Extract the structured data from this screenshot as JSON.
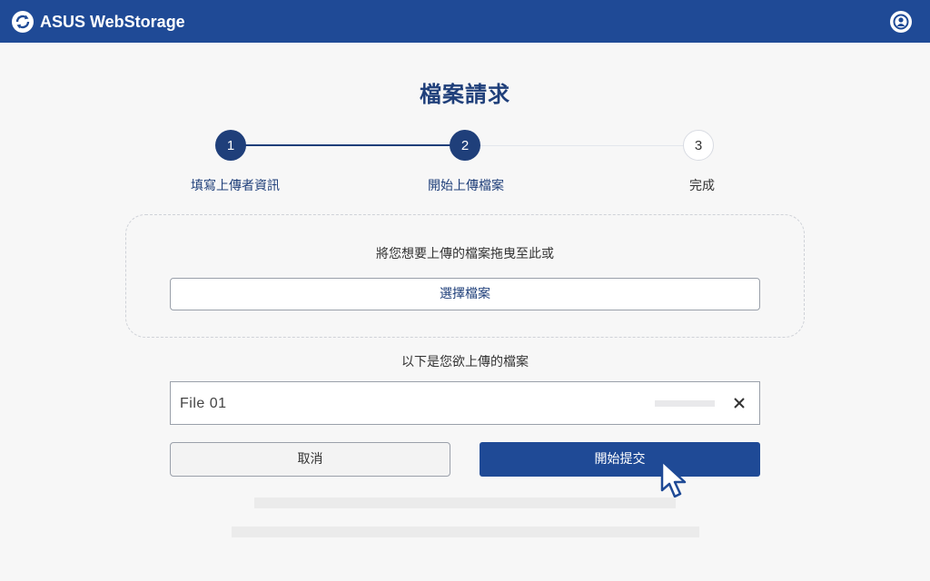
{
  "app": {
    "title": "ASUS WebStorage",
    "logo_icon": "webstorage-logo-icon",
    "account_icon": "user-account-icon",
    "brand_color": "#1f4a96"
  },
  "page": {
    "title": "檔案請求"
  },
  "steps": [
    {
      "number": "1",
      "label": "填寫上傳者資訊",
      "state": "done"
    },
    {
      "number": "2",
      "label": "開始上傳檔案",
      "state": "current"
    },
    {
      "number": "3",
      "label": "完成",
      "state": "pending"
    }
  ],
  "dropzone": {
    "instruction": "將您想要上傳的檔案拖曳至此或",
    "choose_button": "選擇檔案"
  },
  "files": {
    "heading": "以下是您欲上傳的檔案",
    "items": [
      {
        "name": "File 01",
        "progress": 0,
        "remove_icon": "close-icon"
      }
    ]
  },
  "actions": {
    "cancel_label": "取消",
    "submit_label": "開始提交"
  }
}
